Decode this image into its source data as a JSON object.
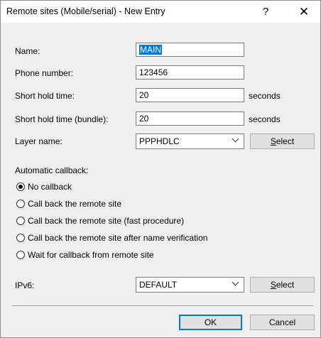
{
  "window": {
    "title": "Remote sites (Mobile/serial) - New Entry",
    "help_label": "?",
    "close_label": "✕"
  },
  "form": {
    "name": {
      "label": "Name:",
      "value": "MAIN"
    },
    "phone": {
      "label": "Phone number:",
      "value": "123456"
    },
    "short_hold": {
      "label": "Short hold time:",
      "value": "20",
      "unit": "seconds"
    },
    "short_hold_bundle": {
      "label": "Short hold time (bundle):",
      "value": "20",
      "unit": "seconds"
    },
    "layer": {
      "label": "Layer name:",
      "value": "PPPHDLC",
      "select_first": "S",
      "select_rest": "elect"
    }
  },
  "callback": {
    "label": "Automatic callback:",
    "options": [
      {
        "label": "No callback",
        "selected": true
      },
      {
        "label": "Call back the remote site",
        "selected": false
      },
      {
        "label": "Call back the remote site (fast procedure)",
        "selected": false
      },
      {
        "label": "Call back the remote site after name verification",
        "selected": false
      },
      {
        "label": "Wait for callback from remote site",
        "selected": false
      }
    ]
  },
  "ipv6": {
    "label": "IPv6:",
    "value": "DEFAULT",
    "select_first": "S",
    "select_rest": "elect"
  },
  "footer": {
    "ok_label": "OK",
    "cancel_label": "Cancel"
  },
  "colors": {
    "selection": "#0078d7",
    "dialog_bg": "#f0f0f0"
  }
}
